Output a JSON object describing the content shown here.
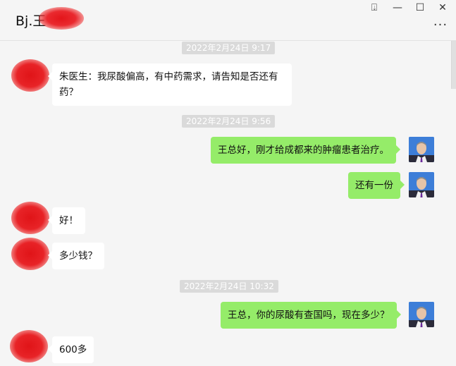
{
  "window": {
    "title": "Bj.王",
    "pin_icon": "pin-icon",
    "minimize_icon": "minimize-icon",
    "maximize_icon": "maximize-icon",
    "close_icon": "close-icon",
    "more_icon": "more-icon",
    "pin_glyph": "⍗",
    "minimize_glyph": "—",
    "maximize_glyph": "☐",
    "close_glyph": "✕",
    "more_glyph": "···"
  },
  "colors": {
    "outgoing_bubble": "#95ec69",
    "incoming_bubble": "#ffffff",
    "timestamp_bg": "#dadada",
    "background": "#f5f5f5"
  },
  "timestamps": [
    "2022年2月24日 9:17",
    "2022年2月24日 9:56",
    "2022年2月24日 10:32"
  ],
  "messages": [
    {
      "from": "contact",
      "text_line1": "朱医生：我尿酸偏高，有中药需求，请告知是否还有",
      "text_line2": "药？"
    },
    {
      "from": "me",
      "text": "王总好，刚才给成都来的肿瘤患者治疗。"
    },
    {
      "from": "me",
      "text": "还有一份"
    },
    {
      "from": "contact",
      "text": "好！"
    },
    {
      "from": "contact",
      "text": "多少钱？"
    },
    {
      "from": "me",
      "text": "王总，你的尿酸有查国吗，现在多少？"
    },
    {
      "from": "contact",
      "text": "600多"
    }
  ]
}
